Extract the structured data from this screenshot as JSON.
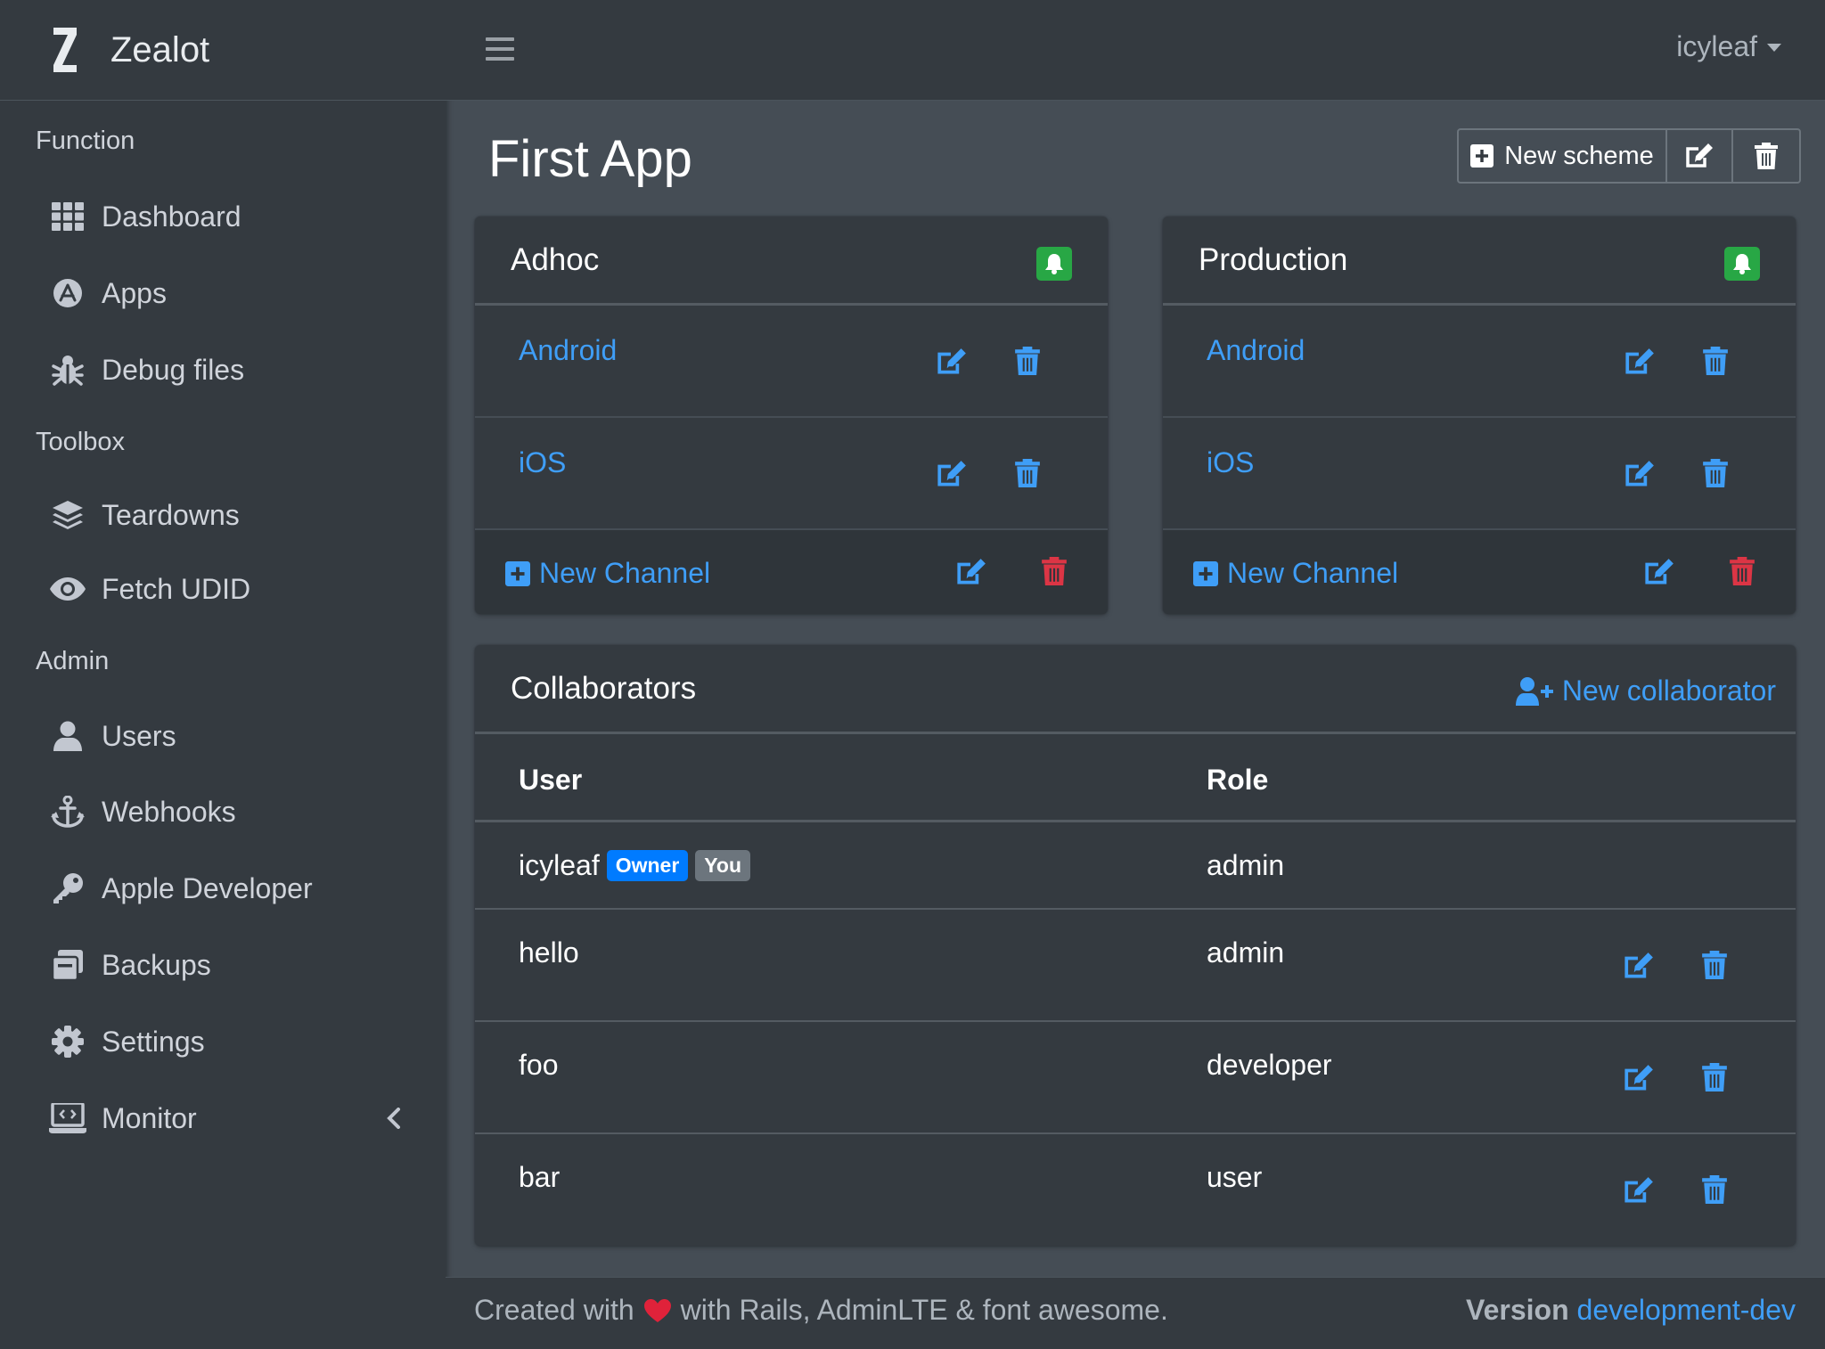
{
  "brand": {
    "name": "Zealot"
  },
  "topbar": {
    "user": "icyleaf"
  },
  "sidebar": {
    "sections": [
      {
        "header": "Function",
        "items": [
          {
            "label": "Dashboard",
            "icon": "grid-icon"
          },
          {
            "label": "Apps",
            "icon": "app-store-icon"
          },
          {
            "label": "Debug files",
            "icon": "bug-icon"
          }
        ]
      },
      {
        "header": "Toolbox",
        "items": [
          {
            "label": "Teardowns",
            "icon": "layers-icon"
          },
          {
            "label": "Fetch UDID",
            "icon": "eye-icon"
          }
        ]
      },
      {
        "header": "Admin",
        "items": [
          {
            "label": "Users",
            "icon": "user-icon"
          },
          {
            "label": "Webhooks",
            "icon": "anchor-icon"
          },
          {
            "label": "Apple Developer",
            "icon": "key-icon"
          },
          {
            "label": "Backups",
            "icon": "archive-icon"
          },
          {
            "label": "Settings",
            "icon": "gear-icon"
          },
          {
            "label": "Monitor",
            "icon": "laptop-code-icon"
          }
        ]
      }
    ]
  },
  "page": {
    "title": "First App",
    "new_scheme_label": "New scheme"
  },
  "schemes": [
    {
      "title": "Adhoc",
      "channels": [
        "Android",
        "iOS"
      ],
      "new_channel_label": "New Channel"
    },
    {
      "title": "Production",
      "channels": [
        "Android",
        "iOS"
      ],
      "new_channel_label": "New Channel"
    }
  ],
  "collaborators": {
    "title": "Collaborators",
    "new_label": "New collaborator",
    "columns": {
      "user": "User",
      "role": "Role"
    },
    "rows": [
      {
        "user": "icyleaf",
        "role": "admin",
        "badge_owner": "Owner",
        "badge_you": "You"
      },
      {
        "user": "hello",
        "role": "admin"
      },
      {
        "user": "foo",
        "role": "developer"
      },
      {
        "user": "bar",
        "role": "user"
      }
    ]
  },
  "footer": {
    "created_prefix": "Created with",
    "created_suffix": "with Rails, AdminLTE & font awesome.",
    "version_label": "Version",
    "version_value": "development-dev"
  },
  "colors": {
    "link": "#3f9ef7",
    "danger": "#dc3545",
    "success": "#28a745",
    "primary": "#007bff"
  }
}
